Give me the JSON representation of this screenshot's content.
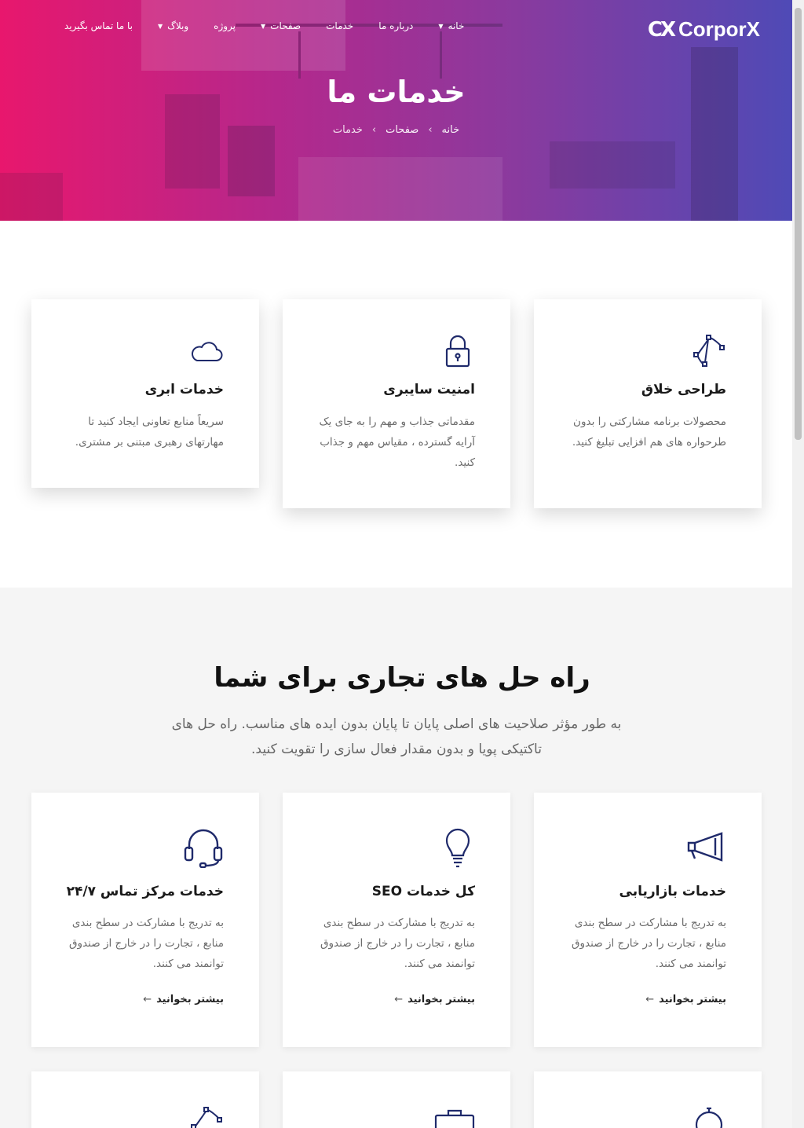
{
  "header": {
    "logo_mark": "CX",
    "logo_text": "CorporX",
    "nav": [
      {
        "label": "خانه",
        "has_caret": true
      },
      {
        "label": "درباره ما",
        "has_caret": false
      },
      {
        "label": "خدمات",
        "has_caret": false
      },
      {
        "label": "صفحات",
        "has_caret": true
      },
      {
        "label": "پروژه",
        "has_caret": false
      },
      {
        "label": "وبلاگ",
        "has_caret": true
      },
      {
        "label": "با ما تماس بگیرید",
        "has_caret": false
      }
    ]
  },
  "hero": {
    "title": "خدمات ما",
    "breadcrumb": [
      "خانه",
      "صفحات",
      "خدمات"
    ]
  },
  "top_cards": [
    {
      "icon": "pen-tool-icon",
      "title": "طراحی خلاق",
      "desc": "محصولات برنامه مشارکتی را بدون طرحواره های هم افزایی تبلیغ کنید."
    },
    {
      "icon": "lock-icon",
      "title": "امنیت سایبری",
      "desc": "مقدماتی جذاب و مهم را به جای یک آرایه گسترده ، مقیاس مهم و جذاب کنید."
    },
    {
      "icon": "cloud-icon",
      "title": "خدمات ابری",
      "desc": "سریعاً منابع تعاونی ایجاد کنید تا مهارتهای رهبری مبتنی بر مشتری."
    }
  ],
  "solutions": {
    "title": "راه حل های تجاری برای شما",
    "subtitle": "به طور مؤثر صلاحیت های اصلی پایان تا پایان بدون ایده های مناسب. راه حل های تاکتیکی پویا و بدون مقدار فعال سازی را تقویت کنید.",
    "read_more": "بیشتر بخوانید",
    "cards": [
      {
        "icon": "megaphone-icon",
        "title": "خدمات بازاریابی",
        "desc": "به تدریج با مشارکت در سطح بندی منابع ، تجارت را در خارج از صندوق توانمند می کنند."
      },
      {
        "icon": "lightbulb-icon",
        "title": "کل خدمات SEO",
        "desc": "به تدریج با مشارکت در سطح بندی منابع ، تجارت را در خارج از صندوق توانمند می کنند."
      },
      {
        "icon": "headset-icon",
        "title": "خدمات مرکز تماس ۲۴/۷",
        "desc": "به تدریج با مشارکت در سطح بندی منابع ، تجارت را در خارج از صندوق توانمند می کنند."
      }
    ],
    "partial_row_icons": [
      "stopwatch-icon",
      "briefcase-icon",
      "pen-tool-icon"
    ]
  },
  "colors": {
    "gradient_start": "#e8176d",
    "gradient_end": "#4f4ab6",
    "icon_navy": "#1f2a6b"
  }
}
